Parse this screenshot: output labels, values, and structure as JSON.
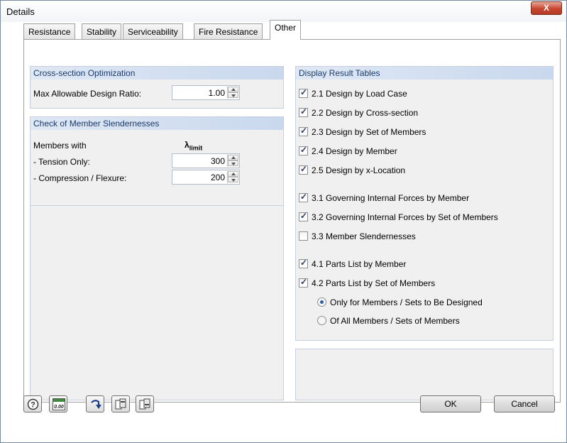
{
  "window": {
    "title": "Details",
    "close_glyph": "X"
  },
  "tabs": [
    {
      "label": "Resistance"
    },
    {
      "label": "Stability"
    },
    {
      "label": "Serviceability"
    },
    {
      "label": "Fire Resistance"
    },
    {
      "label": "Other",
      "active": true
    }
  ],
  "optimization": {
    "header": "Cross-section Optimization",
    "max_ratio_label": "Max Allowable Design Ratio:",
    "max_ratio_value": "1.00"
  },
  "slenderness": {
    "header": "Check of Member Slendernesses",
    "members_with": "Members with",
    "lambda_symbol": "λ",
    "lambda_sub": "limit",
    "tension_label": "- Tension Only:",
    "tension_value": "300",
    "compression_label": "- Compression / Flexure:",
    "compression_value": "200"
  },
  "result_tables": {
    "header": "Display Result Tables",
    "items": [
      {
        "label": "2.1 Design by Load Case",
        "checked": true
      },
      {
        "label": "2.2 Design by Cross-section",
        "checked": true
      },
      {
        "label": "2.3 Design by Set of Members",
        "checked": true
      },
      {
        "label": "2.4 Design by Member",
        "checked": true
      },
      {
        "label": "2.5 Design by x-Location",
        "checked": true
      },
      {
        "label": "3.1 Governing Internal Forces by Member",
        "checked": true
      },
      {
        "label": "3.2 Governing Internal Forces by Set of Members",
        "checked": true
      },
      {
        "label": "3.3 Member Slendernesses",
        "checked": false
      },
      {
        "label": "4.1 Parts List by Member",
        "checked": true
      },
      {
        "label": "4.2 Parts List by Set of Members",
        "checked": true
      }
    ],
    "radios": [
      {
        "label": "Only for Members / Sets to Be Designed",
        "selected": true
      },
      {
        "label": "Of All Members / Sets of Members",
        "selected": false
      }
    ]
  },
  "footer": {
    "icons": [
      "help-icon",
      "decimal-places-icon",
      "reset-icon",
      "export-icon",
      "import-icon"
    ],
    "decimal_icon_text": "0.00",
    "ok_label": "OK",
    "cancel_label": "Cancel"
  }
}
